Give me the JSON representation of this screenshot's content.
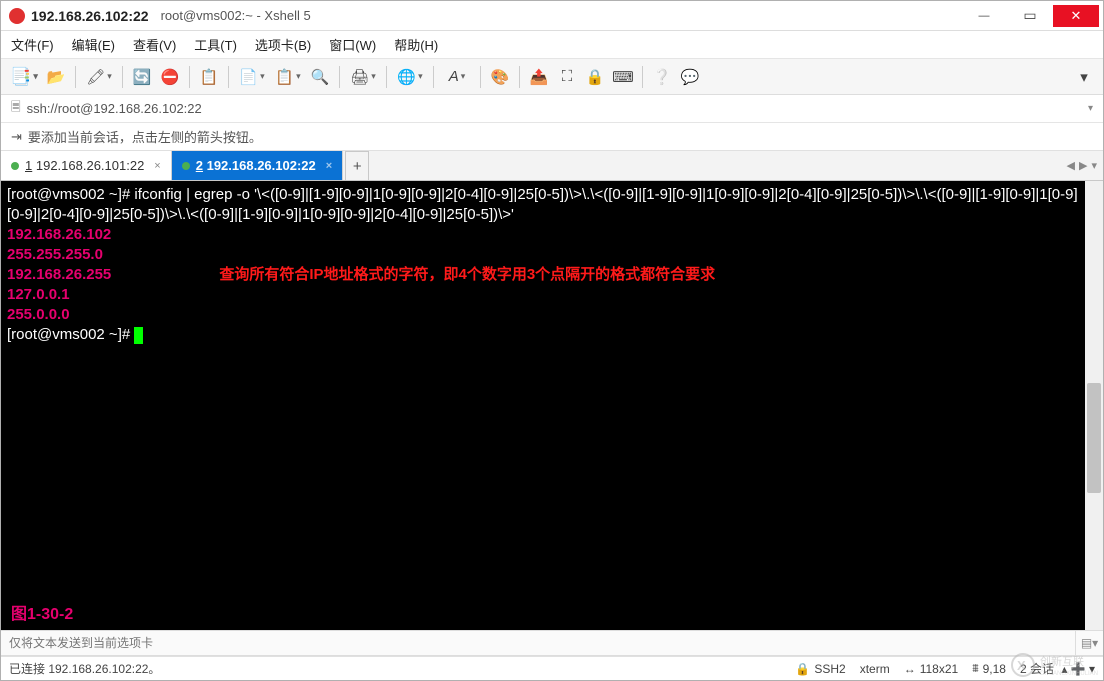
{
  "window": {
    "host": "192.168.26.102:22",
    "title": "root@vms002:~ - Xshell 5"
  },
  "menu": {
    "file": "文件(F)",
    "edit": "编辑(E)",
    "view": "查看(V)",
    "tools": "工具(T)",
    "tab": "选项卡(B)",
    "window": "窗口(W)",
    "help": "帮助(H)"
  },
  "address": {
    "url": "ssh://root@192.168.26.102:22"
  },
  "hint": {
    "text": "要添加当前会话，点击左侧的箭头按钮。"
  },
  "tabs": {
    "tab1": {
      "index": "1",
      "label": "192.168.26.101:22"
    },
    "tab2": {
      "index": "2",
      "label": "192.168.26.102:22"
    }
  },
  "terminal": {
    "cmd_line": "[root@vms002 ~]# ifconfig | egrep -o '\\<([0-9]|[1-9][0-9]|1[0-9][0-9]|2[0-4][0-9]|25[0-5])\\>\\.\\<([0-9]|[1-9][0-9]|1[0-9][0-9]|2[0-4][0-9]|25[0-5])\\>\\.\\<([0-9]|[1-9][0-9]|1[0-9][0-9]|2[0-4][0-9]|25[0-5])\\>\\.\\<([0-9]|[1-9][0-9]|1[0-9][0-9]|2[0-4][0-9]|25[0-5])\\>'",
    "outputs": [
      "192.168.26.102",
      "255.255.255.0",
      "192.168.26.255",
      "127.0.0.1",
      "255.0.0.0"
    ],
    "prompt2": "[root@vms002 ~]# ",
    "annotation": "查询所有符合IP地址格式的字符，即4个数字用3个点隔开的格式都符合要求",
    "fig_label": "图1-30-2"
  },
  "inputbar": {
    "placeholder": "仅将文本发送到当前选项卡"
  },
  "status": {
    "connected": "已连接 192.168.26.102:22。",
    "ssh": "SSH2",
    "term": "xterm",
    "size": "118x21",
    "cursor": "9,18",
    "sessions": "2 会话"
  },
  "icons": {
    "lock": "🔒",
    "size_arrows": "↔",
    "caps": "⩩"
  },
  "watermark": {
    "brand": "创新互联"
  }
}
